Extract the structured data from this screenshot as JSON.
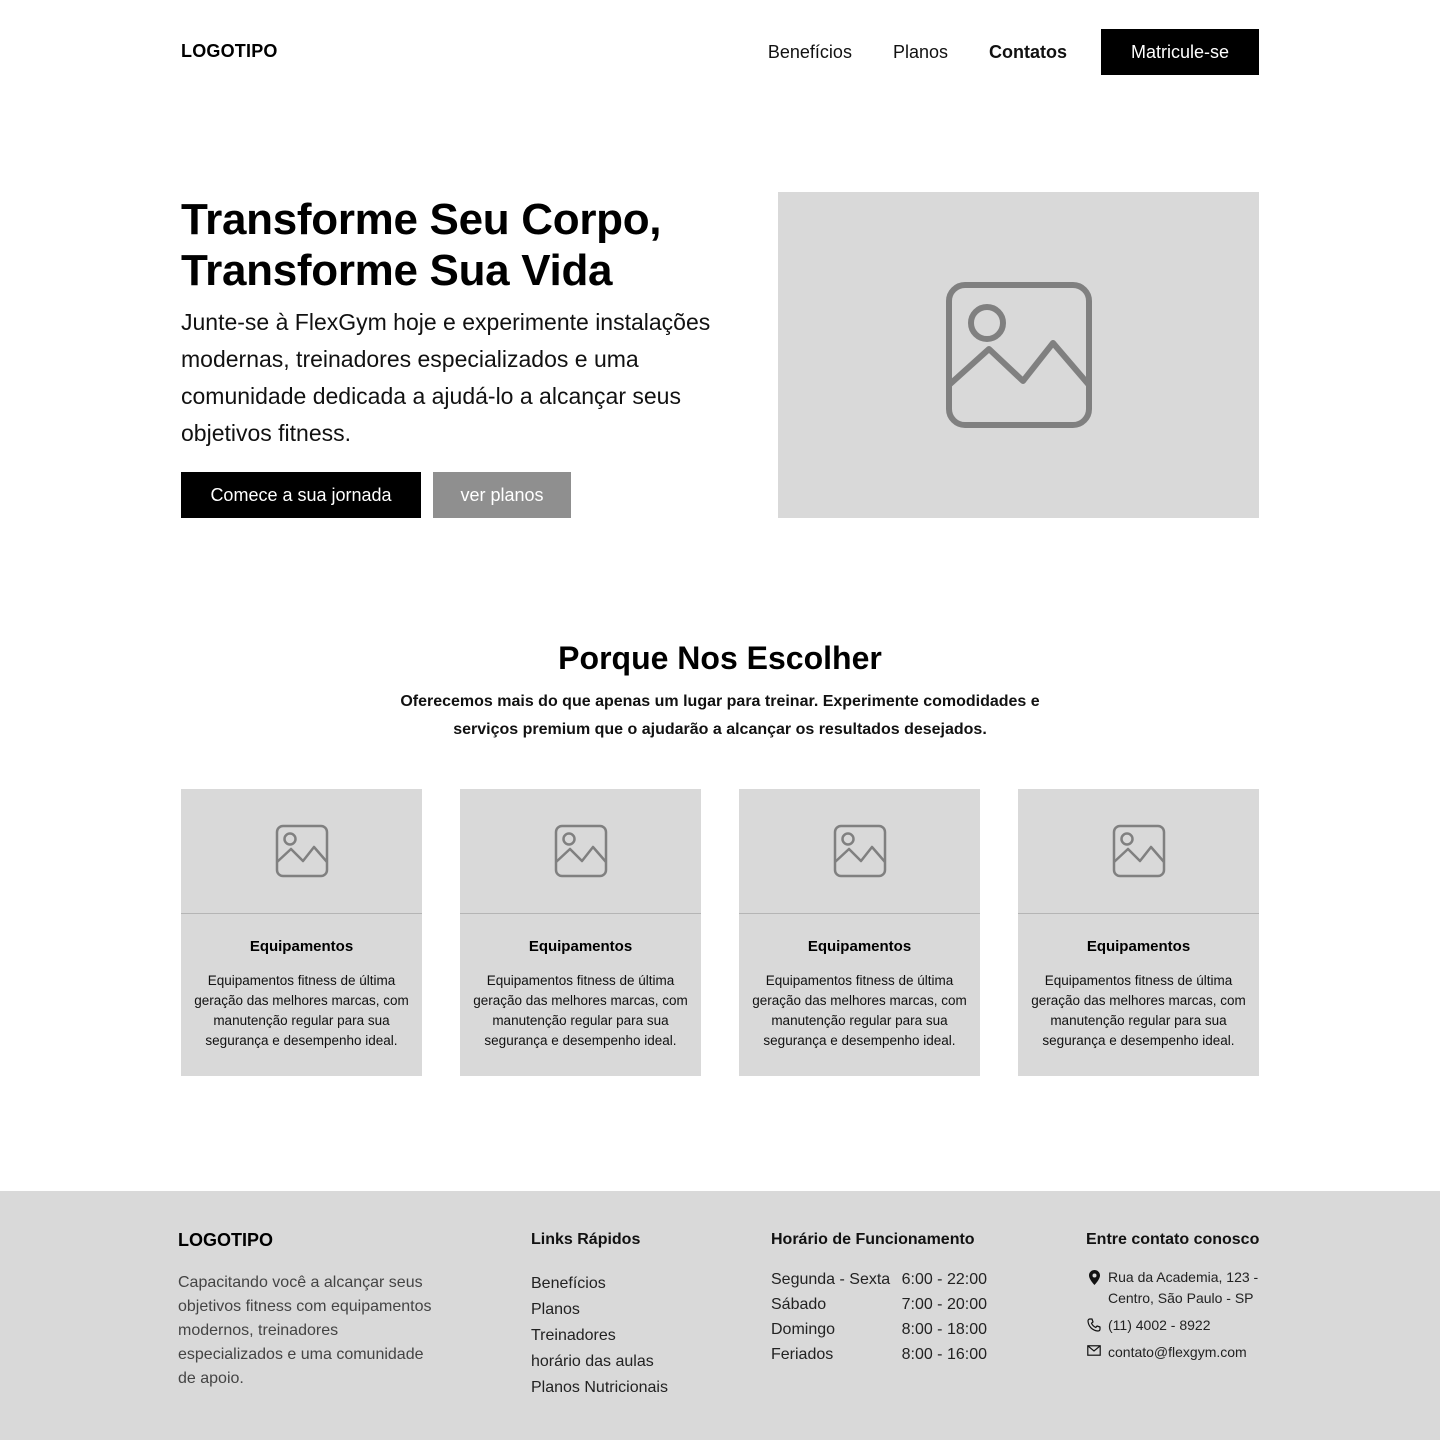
{
  "header": {
    "logo": "LOGOTIPO",
    "nav": [
      "Benefícios",
      "Planos",
      "Contatos"
    ],
    "cta": "Matricule-se"
  },
  "hero": {
    "title_line1": "Transforme Seu Corpo,",
    "title_line2": "Transforme Sua Vida",
    "text": "Junte-se à FlexGym hoje e experimente instalações modernas, treinadores especializados e uma comunidade dedicada a ajudá-lo a alcançar seus objetivos fitness.",
    "primary_button": "Comece a sua jornada",
    "secondary_button": "ver planos",
    "image_icon": "image-placeholder-icon"
  },
  "why": {
    "title": "Porque Nos Escolher",
    "subtitle": "Oferecemos mais do que apenas um lugar para treinar. Experimente comodidades e serviços premium que o ajudarão a alcançar os resultados desejados.",
    "cards": [
      {
        "title": "Equipamentos",
        "text": "Equipamentos fitness de última geração das melhores marcas, com manutenção regular para sua segurança e desempenho ideal."
      },
      {
        "title": "Equipamentos",
        "text": "Equipamentos fitness de última geração das melhores marcas, com manutenção regular para sua segurança e desempenho ideal."
      },
      {
        "title": "Equipamentos",
        "text": "Equipamentos fitness de última geração das melhores marcas, com manutenção regular para sua segurança e desempenho ideal."
      },
      {
        "title": "Equipamentos",
        "text": "Equipamentos fitness de última geração das melhores marcas, com manutenção regular para sua segurança e desempenho ideal."
      }
    ]
  },
  "footer": {
    "logo": "LOGOTIPO",
    "description": "Capacitando você a alcançar seus objetivos fitness com equipamentos modernos, treinadores especializados e uma comunidade de apoio.",
    "links_title": "Links Rápidos",
    "links": [
      "Benefícios",
      "Planos",
      "Treinadores",
      "horário das aulas",
      "Planos Nutricionais"
    ],
    "hours_title": "Horário de Funcionamento",
    "hours": [
      {
        "day": "Segunda - Sexta",
        "time": "6:00 - 22:00"
      },
      {
        "day": "Sábado",
        "time": "7:00 - 20:00"
      },
      {
        "day": "Domingo",
        "time": "8:00 - 18:00"
      },
      {
        "day": "Feriados",
        "time": "8:00 - 16:00"
      }
    ],
    "contact_title": "Entre contato conosco",
    "address": "Rua da Academia, 123 - Centro, São Paulo - SP",
    "phone": "(11) 4002 - 8922",
    "email": "contato@flexgym.com"
  },
  "colors": {
    "placeholder_bg": "#d9d9d9",
    "primary": "#000000",
    "secondary_button": "#8f8f8f",
    "icon_gray": "#808080"
  }
}
